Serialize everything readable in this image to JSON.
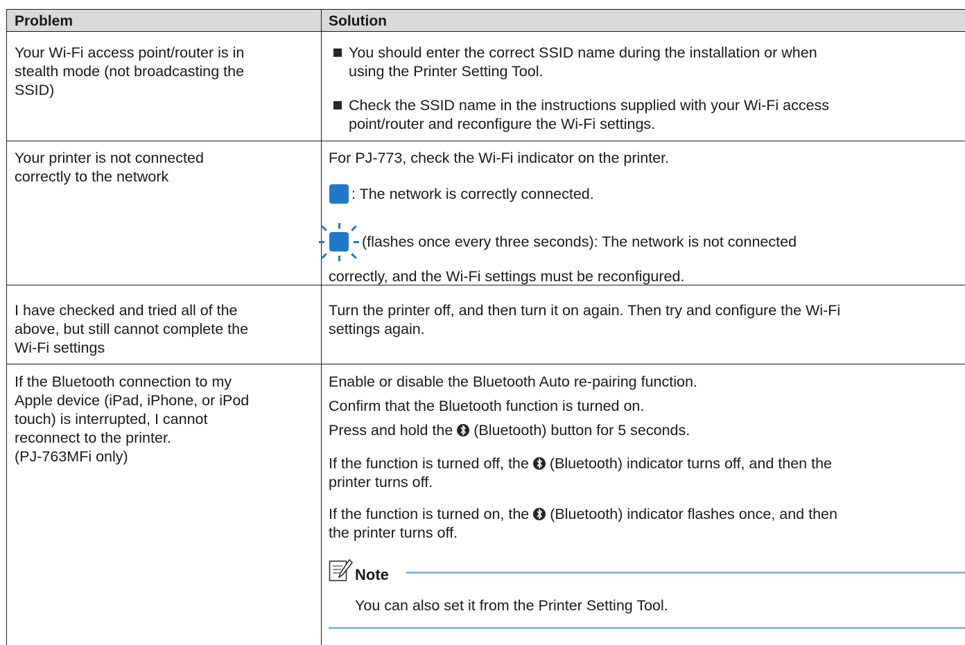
{
  "header": {
    "problem": "Problem",
    "solution": "Solution"
  },
  "rows": [
    {
      "problem": [
        "Your Wi-Fi access point/router is in",
        "stealth mode (not broadcasting the",
        "SSID)"
      ],
      "bullets": [
        [
          "You should enter the correct SSID name during the installation or when",
          "using the Printer Setting Tool."
        ],
        [
          "Check the SSID name in the instructions supplied with your Wi-Fi access",
          "point/router and reconfigure the Wi-Fi settings."
        ]
      ]
    },
    {
      "problem": [
        "Your printer is not connected",
        "correctly to the network"
      ],
      "intro": "For PJ-773, check the Wi-Fi indicator on the printer.",
      "led_on": ": The network is correctly connected.",
      "led_flash": "(flashes once every three seconds): The network is not connected",
      "led_flash_cont": "correctly, and the Wi-Fi settings must be reconfigured.",
      "led_color": "#1f78c8"
    },
    {
      "problem": [
        "I have checked and tried all of the",
        "above, but still cannot complete the",
        "Wi-Fi settings"
      ],
      "solution": [
        "Turn the printer off, and then turn it on again. Then try and configure the Wi-Fi",
        "settings again."
      ]
    },
    {
      "problem": [
        "If the Bluetooth connection to my",
        "Apple device (iPad, iPhone, or iPod",
        "touch) is interrupted, I cannot",
        "reconnect to the printer.",
        "(PJ-763MFi only)"
      ],
      "s1": "Enable or disable the Bluetooth Auto re-pairing function.",
      "s2": "Confirm that the Bluetooth function is turned on.",
      "s3a": "Press and hold the",
      "s3b": "(Bluetooth) button for 5 seconds.",
      "s4a": "If the function is turned off, the",
      "s4b": "(Bluetooth) indicator turns off, and then the",
      "s4c": "printer turns off.",
      "s5a": "If the function is turned on, the",
      "s5b": "(Bluetooth) indicator flashes once, and then",
      "s5c": "the printer turns off.",
      "note_title": "Note",
      "note_text": "You can also set it from the Printer Setting Tool.",
      "icons": [
        "bluetooth-icon",
        "note-icon"
      ]
    }
  ]
}
